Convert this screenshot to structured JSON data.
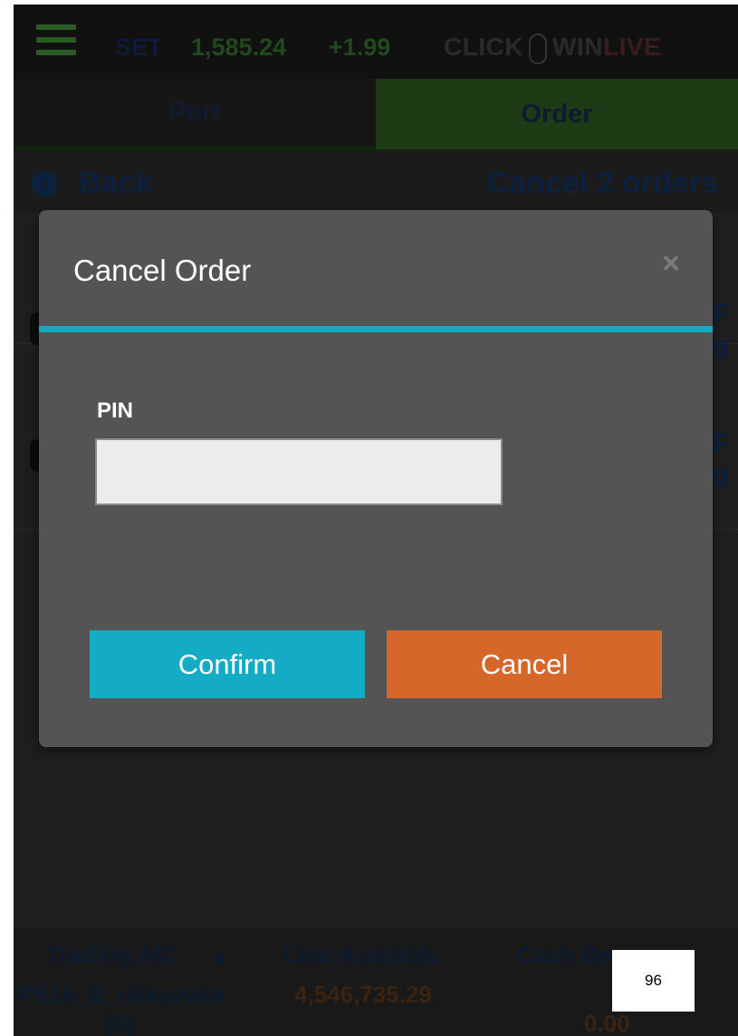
{
  "topbar": {
    "index_name": "SET",
    "index_value": "1,585.24",
    "index_change": "+1.99",
    "brand_prefix": "CLICK",
    "brand_mid": "WIN",
    "brand_suffix": "LIVE"
  },
  "tabs": [
    {
      "label": "Port"
    },
    {
      "label": "Order"
    }
  ],
  "backbar": {
    "back_label": "Back",
    "action_label": "Cancel 2 orders"
  },
  "rows": [
    {
      "side_line1": "F",
      "side_line2": "g"
    },
    {
      "side_line1": "F",
      "side_line2": "g"
    }
  ],
  "bottombar": {
    "trading_label": "Trading A/C",
    "account_line1": "PE16_E_rikkuzaka",
    "account_line2": "(E)",
    "line_available_label": "Line Available",
    "line_available_value": "4,546,735.29",
    "cash_balance_label": "Cash Balance",
    "cash_balance_value": "0.00"
  },
  "modal": {
    "title": "Cancel Order",
    "close_glyph": "×",
    "pin_label": "PIN",
    "pin_value": "",
    "confirm_label": "Confirm",
    "cancel_label": "Cancel"
  },
  "page_number": "96",
  "colors": {
    "modal_bg": "#545454",
    "accent": "#13a9c3",
    "confirm": "#14acc4",
    "cancel": "#d6672b"
  }
}
